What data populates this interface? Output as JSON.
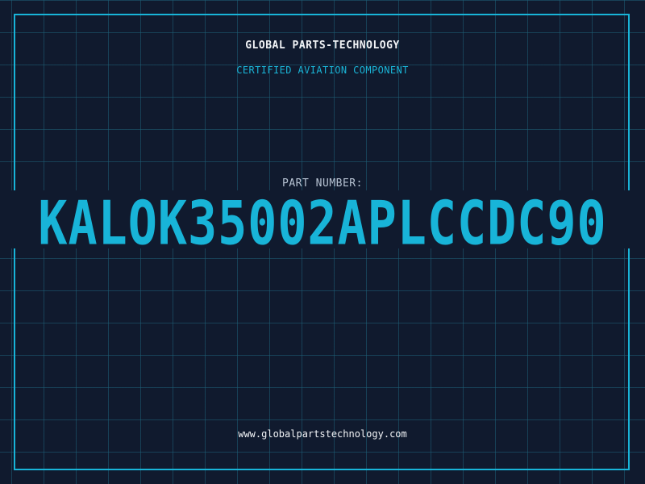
{
  "header": {
    "company": "GLOBAL PARTS-TECHNOLOGY",
    "tagline": "CERTIFIED AVIATION COMPONENT"
  },
  "part": {
    "label": "PART NUMBER:",
    "number": "KALOK35002APLCCDC90"
  },
  "footer": {
    "website": "www.globalpartstechnology.com"
  },
  "colors": {
    "background": "#101a2e",
    "grid": "#1e6078",
    "accent": "#18b4d8",
    "text": "#f2f4f7",
    "label": "#b6c2d2"
  }
}
